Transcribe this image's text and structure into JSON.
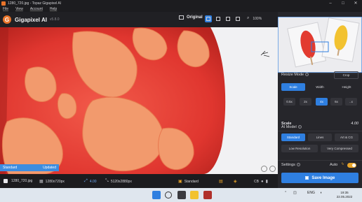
{
  "window": {
    "title": "1280_720.jpg - Topaz Gigapixel AI",
    "minimize": "–",
    "maximize": "□",
    "close": "✕"
  },
  "menu": [
    "File",
    "View",
    "Account",
    "Help"
  ],
  "header": {
    "app_name": "Gigapixel AI",
    "version": "v5.8.0",
    "logo_letter": "G",
    "original_label": "Original",
    "zoom": "100%",
    "zoom_icon": "search-icon"
  },
  "preview": {
    "tag_mode": "Standard",
    "tag_status": "Updated"
  },
  "bottom": {
    "filename": "1280_720.jpg",
    "input_size": "1280x720px",
    "scale": "4.00",
    "output_size": "5120x2880px",
    "model": "Standard",
    "right_label": "CB"
  },
  "panel": {
    "resize_mode_label": "Resize Mode",
    "crop_label": "Crop",
    "mode_tabs": [
      "Scale",
      "Width",
      "Height"
    ],
    "scale_options": [
      "0.5x",
      "2x",
      "4x",
      "6x",
      "..x"
    ],
    "scale_label": "Scale",
    "scale_value": "4.00",
    "ai_model_label": "AI Model",
    "model_tabs": [
      "Standard",
      "Lines",
      "Art & CG"
    ],
    "model_options": [
      "Low Resolution",
      "Very Compressed"
    ],
    "settings_label": "Settings",
    "auto_label": "Auto",
    "save_label": "Save Image"
  },
  "taskbar": {
    "lang": "ENG",
    "time": "19:35",
    "date": "22.05.2022"
  },
  "colors": {
    "accent": "#2f7fe0",
    "brand": "#e8742a",
    "panel": "#26262b"
  }
}
